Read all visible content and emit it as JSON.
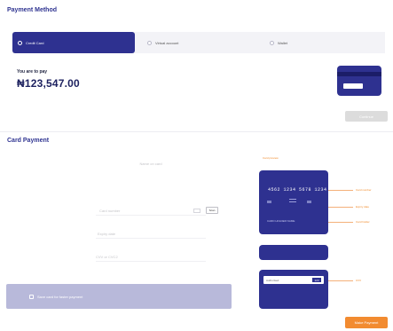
{
  "header": {
    "title": "Payment Method"
  },
  "tabs": [
    {
      "label": "Credit Card",
      "active": true
    },
    {
      "label": "Virtual account",
      "active": false
    },
    {
      "label": "Wallet",
      "active": false
    }
  ],
  "summary": {
    "pay_label": "You are to pay",
    "amount": "₦123,547.00",
    "proceed_label": "Continue"
  },
  "card_section": {
    "title": "Card Payment",
    "fields": {
      "name": "Name on card",
      "number": "Card number",
      "scan": "Scan",
      "expiry": "Expiry date",
      "cvv": "CVV or CVC2"
    },
    "save_label": "Save card for faster payment"
  },
  "preview": {
    "note": "Card preview",
    "number": "4562 1234 5678 1234",
    "holder": "CARD HOLDER NAME",
    "back_signature": "Authorised",
    "back_cvv": "123",
    "callouts": [
      "Card number",
      "Expiry date",
      "Card holder",
      "CVV"
    ]
  },
  "footer": {
    "pay_label": "Make Payment"
  },
  "colors": {
    "primary": "#2e3190",
    "accent": "#f28b30"
  }
}
